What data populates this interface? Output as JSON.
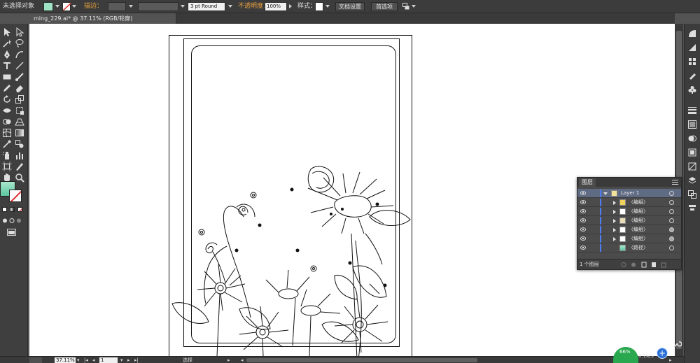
{
  "control_bar": {
    "selection_status": "未选择对象",
    "stroke_label": "描边：",
    "brush_value": "3 pt Round",
    "opacity_label": "不透明度：",
    "opacity_value": "100%",
    "style_label": "样式：",
    "document_setup_button": "文档设置",
    "preferences_button": "首选项"
  },
  "document_tab": {
    "title": "ming_229.ai* @ 37.11% (RGB/轮廓)"
  },
  "status_bar": {
    "zoom": "37.11%",
    "artboard_number": "1",
    "tool_name": "选择"
  },
  "network_widget": {
    "percent": "66%",
    "speed": "0.1K/s"
  },
  "layers_panel": {
    "tab_title": "图层",
    "rows": [
      {
        "name": "Layer 1",
        "indent": 0,
        "expanded": true,
        "selected": true,
        "target_filled": false
      },
      {
        "name": "〈编组〉",
        "indent": 1,
        "expanded": false,
        "selected": false,
        "target_filled": false
      },
      {
        "name": "〈编组〉",
        "indent": 1,
        "expanded": false,
        "selected": false,
        "target_filled": false
      },
      {
        "name": "〈编组〉",
        "indent": 1,
        "expanded": false,
        "selected": false,
        "target_filled": false
      },
      {
        "name": "〈编组〉",
        "indent": 1,
        "expanded": false,
        "selected": false,
        "target_filled": true
      },
      {
        "name": "〈编组〉",
        "indent": 1,
        "expanded": false,
        "selected": false,
        "target_filled": true
      },
      {
        "name": "〈路径〉",
        "indent": 1,
        "expanded": false,
        "selected": false,
        "target_filled": false
      }
    ],
    "footer_count": "1 个图层"
  },
  "colors": {
    "fill_swatch": "#7fd3b0",
    "stroke_none": "#e03030",
    "accent_orange": "#e8a03c",
    "layer_color": "#4f7df5"
  }
}
